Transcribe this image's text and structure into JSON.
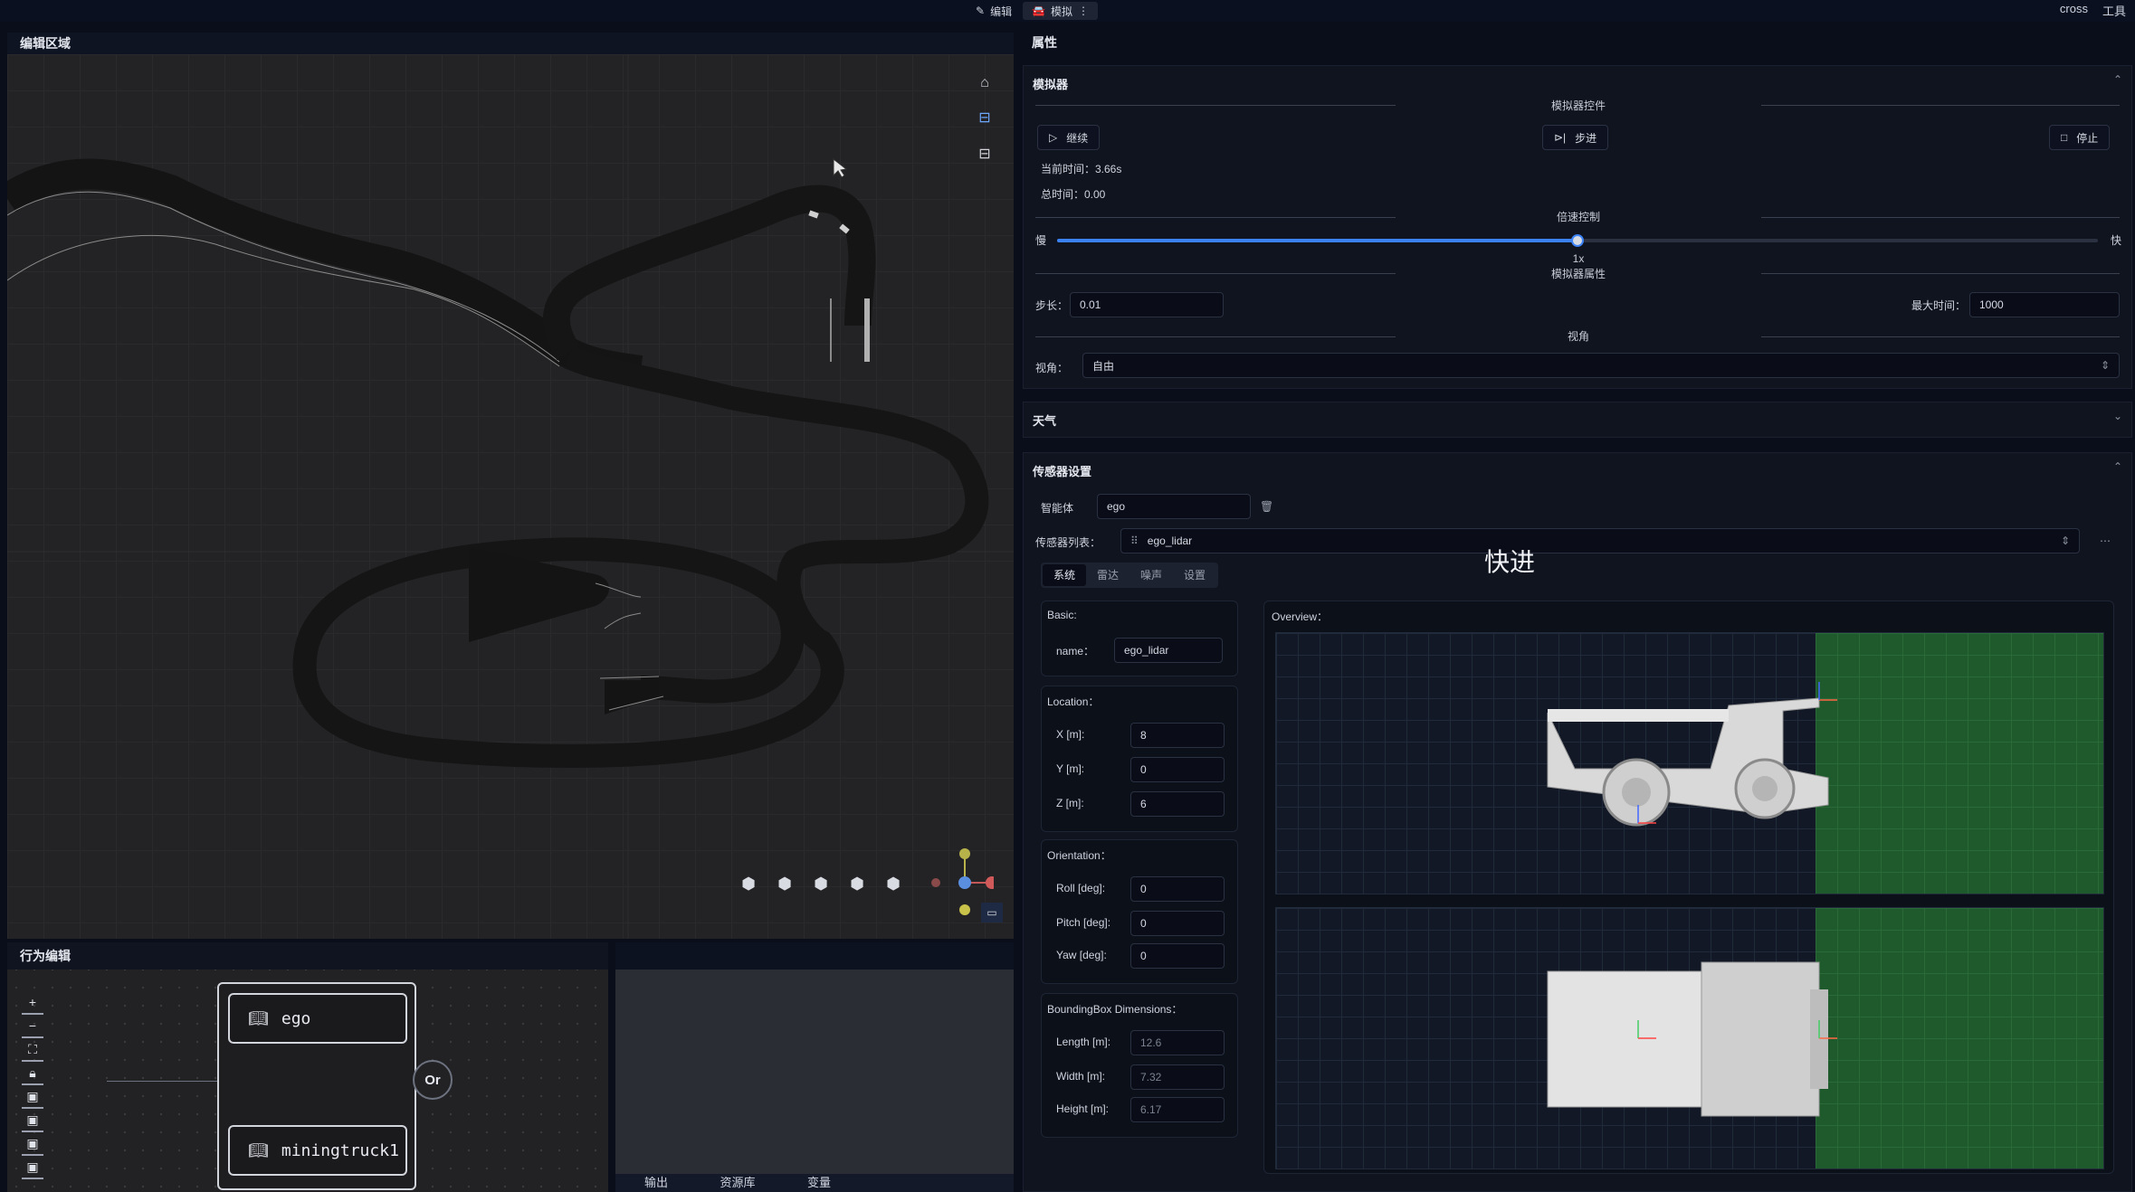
{
  "topbar": {
    "mode_edit": "编辑",
    "mode_sim": "模拟",
    "user": "cross",
    "tools": "工具"
  },
  "editor": {
    "title": "编辑区域"
  },
  "behavior": {
    "title": "行为编辑",
    "node_ego": "ego",
    "node_truck": "miningtruck1",
    "or_label": "Or"
  },
  "output_tabs": [
    "输出",
    "资源库",
    "变量"
  ],
  "properties": {
    "title": "属性",
    "simulator": {
      "title": "模拟器",
      "controls_label": "模拟器控件",
      "continue_label": "继续",
      "step_label": "步进",
      "stop_label": "停止",
      "current_time": "当前时间：3.66s",
      "total_time": "总时间：0.00",
      "speed_label": "倍速控制",
      "slow_label": "慢",
      "fast_label": "快",
      "speed_value": "1x",
      "speed_fraction": 0.5,
      "attrs_label": "模拟器属性",
      "step_size_label": "步长：",
      "step_size": "0.01",
      "max_time_label": "最大时间：",
      "max_time": "1000",
      "view_label": "视角",
      "view_field_label": "视角：",
      "view_value": "自由"
    },
    "weather": {
      "title": "天气"
    },
    "sensor": {
      "title": "传感器设置",
      "agent_label": "智能体",
      "agent_value": "ego",
      "list_label": "传感器列表：",
      "list_value": "ego_lidar",
      "tabs": [
        "系统",
        "雷达",
        "噪声",
        "设置"
      ],
      "basic_title": "Basic:",
      "name_label": "name：",
      "name_value": "ego_lidar",
      "location_title": "Location：",
      "x_label": "X [m]:",
      "x_value": "8",
      "y_label": "Y [m]:",
      "y_value": "0",
      "z_label": "Z [m]:",
      "z_value": "6",
      "orientation_title": "Orientation：",
      "roll_label": "Roll [deg]:",
      "roll_value": "0",
      "pitch_label": "Pitch [deg]:",
      "pitch_value": "0",
      "yaw_label": "Yaw [deg]:",
      "yaw_value": "0",
      "bbox_title": "BoundingBox Dimensions：",
      "length_label": "Length [m]:",
      "length_value": "12.6",
      "width_label": "Width [m]:",
      "width_value": "7.32",
      "height_label": "Height [m]:",
      "height_value": "6.17",
      "overview_title": "Overview："
    }
  },
  "toast": "快进",
  "colors": {
    "accent": "#3b82f6",
    "background": "#0a0e1a",
    "green_zone": "#1f5a2c"
  }
}
